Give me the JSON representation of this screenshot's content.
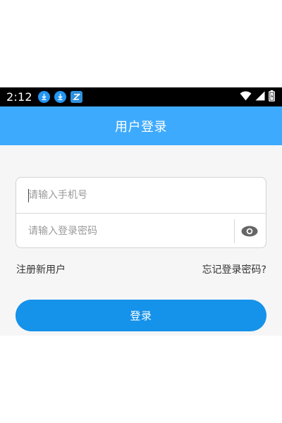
{
  "status_bar": {
    "time": "2:12",
    "notification_icons": [
      "download-icon",
      "download-icon",
      "app-notification-icon"
    ],
    "system_icons": [
      "wifi-icon",
      "cell-signal-icon",
      "battery-icon"
    ]
  },
  "header": {
    "title": "用户登录"
  },
  "form": {
    "phone_placeholder": "请输入手机号",
    "password_placeholder": "请输入登录密码"
  },
  "links": {
    "register": "注册新用户",
    "forgot_password": "忘记登录密码?"
  },
  "login_button": "登录",
  "colors": {
    "app_bar": "#3eaafd",
    "login_button": "#1592ea",
    "content_background": "#f6f6f6",
    "status_bar": "#000000"
  }
}
